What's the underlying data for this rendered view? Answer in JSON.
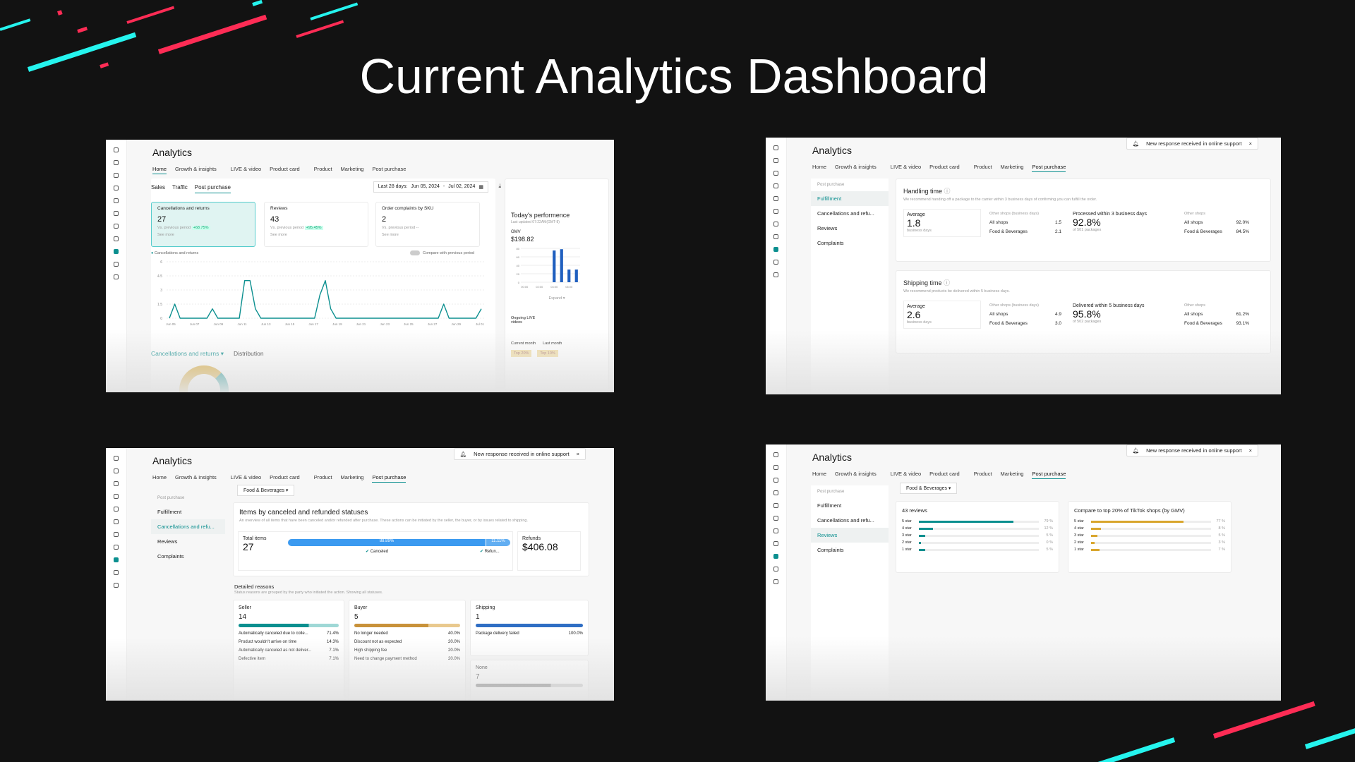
{
  "slide": {
    "title": "Current Analytics Dashboard",
    "colors": {
      "bg": "#121212",
      "cyan": "#25f4ee",
      "red": "#fe2c55",
      "accent": "#0b8f8f"
    }
  },
  "s1": {
    "app_title": "Analytics",
    "nav": [
      "Home",
      "Growth & insights",
      "LIVE & video",
      "Product card",
      "Product",
      "Marketing",
      "Post purchase"
    ],
    "subtabs": [
      "Sales",
      "Traffic",
      "Post purchase"
    ],
    "date_label": "Last 28 days:",
    "date_start": "Jun 05, 2024",
    "date_sep": "-",
    "date_end": "Jul 02, 2024",
    "metrics": [
      {
        "label": "Cancellations and returns",
        "value": "27",
        "sub": "Vs. previous period",
        "delta": "+68.75%",
        "more": "See more"
      },
      {
        "label": "Reviews",
        "value": "43",
        "sub": "Vs. previous period",
        "delta": "+95.45%",
        "more": "See more"
      },
      {
        "label": "Order complaints by SKU",
        "value": "2",
        "sub": "Vs. previous period  --",
        "delta": "",
        "more": "See more"
      }
    ],
    "legend": "Cancellations and returns",
    "compare": "Compare with previous period",
    "chart_data": {
      "type": "line",
      "series": [
        {
          "name": "Cancellations and returns",
          "values": [
            0,
            1.5,
            0,
            0,
            0,
            0,
            0,
            0,
            1,
            0,
            0,
            0,
            0,
            0,
            4,
            4,
            1,
            0,
            0,
            0,
            0,
            0,
            0,
            0,
            0,
            0,
            0,
            0,
            2.5,
            4,
            1,
            0,
            0,
            0,
            0,
            0,
            0,
            0,
            0,
            0,
            0,
            0,
            0,
            0,
            0,
            0,
            0,
            0,
            0,
            0,
            0,
            1.5,
            0,
            0,
            0,
            0,
            0,
            0,
            1
          ]
        }
      ],
      "yticks": [
        "6",
        "4.5",
        "3",
        "1.5",
        "0"
      ],
      "ylim": [
        0,
        6
      ],
      "xticks": [
        "Jun 05",
        "Jun 07",
        "Jun 09",
        "Jun 11",
        "Jun 13",
        "Jun 15",
        "Jun 17",
        "Jun 19",
        "Jun 21",
        "Jun 23",
        "Jun 25",
        "Jun 27",
        "Jun 29",
        "Jul 01"
      ]
    },
    "dropdown": "Cancellations and returns",
    "distribution": "Distribution",
    "perf": {
      "title": "Today's performence",
      "updated": "Last updated 07:22AM(GMT-8)",
      "gmv": "GMV",
      "gmv_value": "$198.82",
      "bars": [
        {
          "t": "00:00",
          "v": 0
        },
        {
          "t": "01:00",
          "v": 0
        },
        {
          "t": "02:00",
          "v": 0
        },
        {
          "t": "03:00",
          "v": 0
        },
        {
          "t": "04:00",
          "v": 75
        },
        {
          "t": "05:00",
          "v": 78
        },
        {
          "t": "06:00",
          "v": 30
        },
        {
          "t": "07:00",
          "v": 30
        }
      ],
      "yticks": [
        "80",
        "60",
        "40",
        "20",
        "0"
      ],
      "xticks": [
        "00:00",
        "02:00",
        "04:00",
        "06:00"
      ],
      "expand": "Expand",
      "ongoing": "Ongoing LIVE videos",
      "current": "Current month",
      "last": "Last month",
      "top1": "Top 20%",
      "top2": "Top 10%"
    }
  },
  "s2": {
    "app_title": "Analytics",
    "toast": "New response received in online support",
    "toast_close": "×",
    "side_header": "Post purchase",
    "side": [
      "Fulfillment",
      "Cancellations and refu...",
      "Reviews",
      "Complaints"
    ],
    "blocks": [
      {
        "title": "Handling time",
        "desc": "We recommend handing off a package to the carrier within 3 business days of confirming you can fulfill the order.",
        "avg_label": "Average",
        "avg": "1.8",
        "unit": "business days",
        "other_label": "Other shops (business days)",
        "rows": [
          [
            "All shops",
            "1.5"
          ],
          [
            "Food & Beverages",
            "2.1"
          ]
        ],
        "pct_label": "Processed within 3 business days",
        "pct": "92.8%",
        "pct_sub": "of 501 packages",
        "other2": "Other shops",
        "rows2": [
          [
            "All shops",
            "92.0%"
          ],
          [
            "Food & Beverages",
            "84.5%"
          ]
        ]
      },
      {
        "title": "Shipping time",
        "desc": "We recommend products be delivered within 5 business days.",
        "avg_label": "Average",
        "avg": "2.6",
        "unit": "business days",
        "other_label": "Other shops (business days)",
        "rows": [
          [
            "All shops",
            "4.9"
          ],
          [
            "Food & Beverages",
            "3.0"
          ]
        ],
        "pct_label": "Delivered within 5 business days",
        "pct": "95.8%",
        "pct_sub": "of 502 packages",
        "other2": "Other shops",
        "rows2": [
          [
            "All shops",
            "61.2%"
          ],
          [
            "Food & Beverages",
            "93.1%"
          ]
        ]
      }
    ]
  },
  "s3": {
    "app_title": "Analytics",
    "toast": "New response received in online support",
    "toast_close": "×",
    "filter": "Food & Beverages",
    "side_header": "Post purchase",
    "side": [
      "Fulfillment",
      "Cancellations and refu...",
      "Reviews",
      "Complaints"
    ],
    "heading": "Items by canceled and refunded statuses",
    "desc": "An overview of all items that have been canceled and/or refunded after purchase. These actions can be initiated by the seller, the buyer, or by issues related to shipping.",
    "total_label": "Total items",
    "total": "27",
    "canceled_pct": "88.89%",
    "refund_pct": "11.11%",
    "canceled": "Canceled",
    "refunded": "Refun...",
    "refunds_label": "Refunds",
    "refunds": "$406.08",
    "reasons_title": "Detailed reasons",
    "reasons_desc": "Status reasons are grouped by the party who initiated the action. Showing all statuses.",
    "seller": {
      "label": "Seller",
      "value": "14",
      "rows": [
        [
          "Automatically canceled due to colle...",
          "71.4%"
        ],
        [
          "Product wouldn't arrive on time",
          "14.3%"
        ],
        [
          "Automatically canceled as not deliver...",
          "7.1%"
        ],
        [
          "Defective item",
          "7.1%"
        ]
      ]
    },
    "buyer": {
      "label": "Buyer",
      "value": "5",
      "rows": [
        [
          "No longer needed",
          "40.0%"
        ],
        [
          "Discount not as expected",
          "20.0%"
        ],
        [
          "High shipping fee",
          "20.0%"
        ],
        [
          "Need to change payment method",
          "20.0%"
        ]
      ]
    },
    "shipping": {
      "label": "Shipping",
      "value": "1",
      "rows": [
        [
          "Package delivery failed",
          "100.0%"
        ]
      ]
    },
    "none": {
      "label": "None",
      "value": "7"
    }
  },
  "s4": {
    "app_title": "Analytics",
    "toast": "New response received in online support",
    "toast_close": "×",
    "filter": "Food & Beverages",
    "side_header": "Post purchase",
    "side": [
      "Fulfillment",
      "Cancellations and refu...",
      "Reviews",
      "Complaints"
    ],
    "reviews_title": "43 reviews",
    "compare_title": "Compare to top 20% of TikTok shops (by GMV)",
    "reviews": [
      {
        "l": "5 star",
        "v": 79
      },
      {
        "l": "4 star",
        "v": 12
      },
      {
        "l": "3 star",
        "v": 5
      },
      {
        "l": "2 star",
        "v": 0
      },
      {
        "l": "1 star",
        "v": 5
      }
    ],
    "compare": [
      {
        "l": "5 star",
        "v": 77
      },
      {
        "l": "4 star",
        "v": 8
      },
      {
        "l": "3 star",
        "v": 5
      },
      {
        "l": "2 star",
        "v": 3
      },
      {
        "l": "1 star",
        "v": 7
      }
    ]
  }
}
